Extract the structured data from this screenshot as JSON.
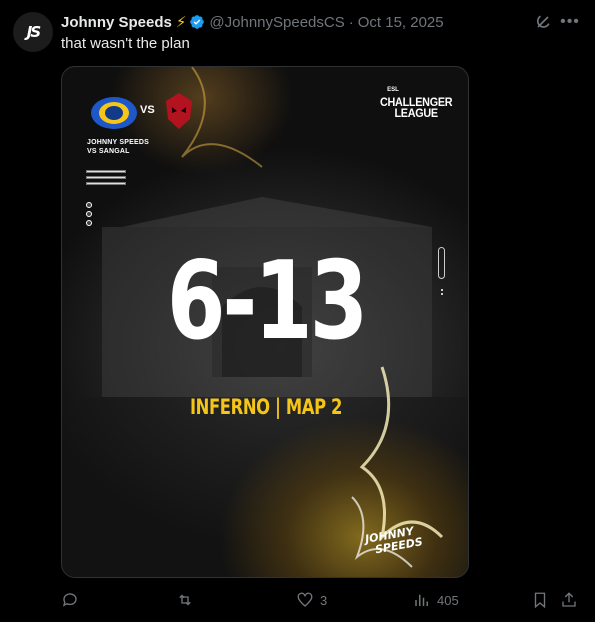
{
  "author": {
    "display_name": "Johnny Speeds",
    "emoji": "⚡",
    "handle": "@JohnnySpeedsCS",
    "separator": "·",
    "date": "Oct 15, 2025",
    "avatar_text": "JS"
  },
  "tweet": {
    "text": "that wasn't the plan"
  },
  "media": {
    "matchup_line1": "JOHNNY SPEEDS",
    "matchup_line2": "VS SANGAL",
    "vs": "VS",
    "league_brand": "ESL",
    "league_line1": "CHALLENGER",
    "league_line2": "LEAGUE",
    "score": "6-13",
    "map_info": "INFERNO | MAP 2",
    "brand_line1": "JOHNNY",
    "brand_line2": "SPEEDS"
  },
  "actions": {
    "reply_count": "",
    "repost_count": "",
    "like_count": "3",
    "view_count": "405"
  },
  "colors": {
    "accent_yellow": "#f5c518",
    "verified_blue": "#1d9bf0",
    "muted": "#71767b"
  },
  "icons": [
    "verified-icon",
    "grok-icon",
    "more-icon",
    "reply-icon",
    "repost-icon",
    "like-icon",
    "views-icon",
    "bookmark-icon",
    "share-icon"
  ]
}
